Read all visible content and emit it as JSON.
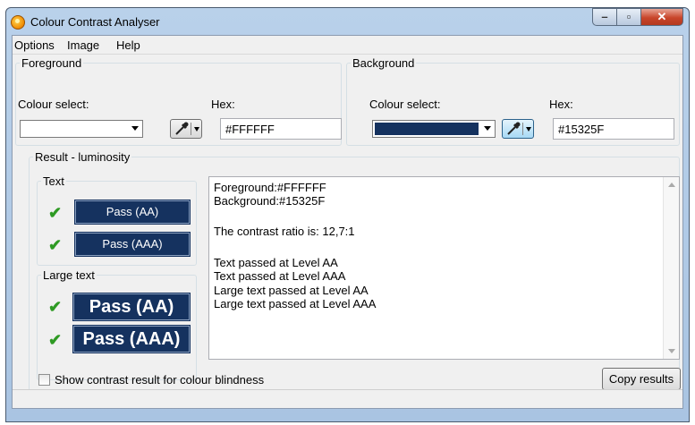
{
  "window": {
    "title": "Colour Contrast Analyser"
  },
  "menu": [
    "Options",
    "Image",
    "Help"
  ],
  "foreground": {
    "legend": "Foreground",
    "colour_select_label": "Colour select:",
    "hex_label": "Hex:",
    "hex_value": "#FFFFFF",
    "swatch_color": "#ffffff"
  },
  "background": {
    "legend": "Background",
    "colour_select_label": "Colour select:",
    "hex_label": "Hex:",
    "hex_value": "#15325F",
    "swatch_color": "#15325f"
  },
  "result": {
    "legend": "Result - luminosity",
    "text_group": {
      "legend": "Text",
      "pass_aa": "Pass (AA)",
      "pass_aaa": "Pass (AAA)"
    },
    "large_text_group": {
      "legend": "Large text",
      "pass_aa": "Pass (AA)",
      "pass_aaa": "Pass (AAA)"
    },
    "lines": [
      "Foreground:#FFFFFF",
      "Background:#15325F",
      "The contrast ratio is: 12,7:1",
      "Text passed at Level AA",
      "Text passed at Level AAA",
      "Large text passed at Level AA",
      "Large text passed at Level AAA"
    ],
    "colorblind_checkbox": "Show contrast result for colour blindness",
    "colorblind_checked": false,
    "copy_button": "Copy results"
  },
  "icons": {
    "app": "app-icon",
    "picker": "eyedropper-icon",
    "check": "checkmark-icon"
  },
  "colors": {
    "pass_box": "#15325f",
    "check": "#2e9a23"
  }
}
